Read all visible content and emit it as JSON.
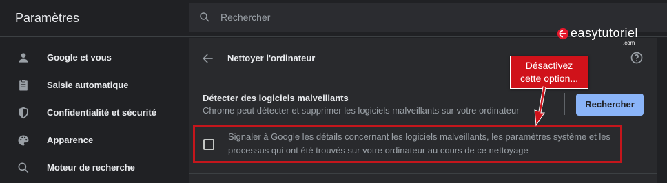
{
  "header": {
    "title": "Paramètres",
    "search_placeholder": "Rechercher"
  },
  "sidebar": {
    "items": [
      {
        "label": "Google et vous",
        "icon": "person-icon"
      },
      {
        "label": "Saisie automatique",
        "icon": "clipboard-icon"
      },
      {
        "label": "Confidentialité et sécurité",
        "icon": "shield-icon"
      },
      {
        "label": "Apparence",
        "icon": "palette-icon"
      },
      {
        "label": "Moteur de recherche",
        "icon": "search-icon"
      }
    ]
  },
  "main": {
    "title": "Nettoyer l'ordinateur",
    "section_title": "Détecter des logiciels malveillants",
    "section_desc": "Chrome peut détecter et supprimer les logiciels malveillants sur votre ordinateur",
    "button_label": "Rechercher",
    "option_text_line1": "Signaler à Google les détails concernant les logiciels malveillants, les paramètres système et les",
    "option_text_line2": "processus qui ont été trouvés sur votre ordinateur au cours de ce nettoyage",
    "option_checked": false
  },
  "annotation": {
    "line1": "Désactivez",
    "line2": "cette option..."
  },
  "watermark": {
    "text": "easytutoriel",
    "sub": ".com"
  },
  "colors": {
    "background": "#202124",
    "panel": "#292a2d",
    "accent": "#8ab4f8",
    "highlight": "#c4161c"
  }
}
